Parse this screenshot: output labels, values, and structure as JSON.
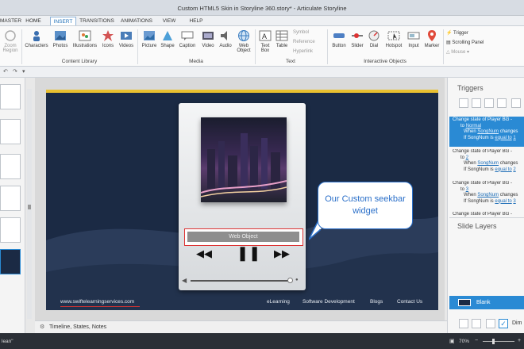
{
  "window": {
    "title": "Custom HTML5 Skin in Storyline 360.story* - Articulate Storyline"
  },
  "tabs": [
    {
      "label": "MASTER"
    },
    {
      "label": "HOME"
    },
    {
      "label": "INSERT"
    },
    {
      "label": "TRANSITIONS"
    },
    {
      "label": "ANIMATIONS"
    },
    {
      "label": "VIEW"
    },
    {
      "label": "HELP"
    }
  ],
  "ribbon": {
    "zoom": "Zoom",
    "region": "Region",
    "characters": "Characters",
    "photos": "Photos",
    "illustrations": "Illustrations",
    "icons": "Icons",
    "videos": "Videos",
    "content_library": "Content Library",
    "picture": "Picture",
    "shape": "Shape",
    "caption": "Caption",
    "video": "Video",
    "audio": "Audio",
    "web": "Web",
    "object": "Object",
    "media": "Media",
    "textbox_1": "Text",
    "textbox_2": "Box",
    "table": "Table",
    "symbol": "Symbol",
    "reference": "Reference",
    "hyperlink": "Hyperlink",
    "text": "Text",
    "button": "Button",
    "slider": "Slider",
    "dial": "Dial",
    "hotspot": "Hotspot",
    "input": "Input",
    "marker": "Marker",
    "interactive_objects": "Interactive Objects",
    "trigger": "Trigger",
    "scrolling_panel": "Scrolling Panel",
    "mouse": "Mouse"
  },
  "slide": {
    "seekbar_label": "Web Object",
    "callout": "Our Custom seekbar widget",
    "footer": {
      "website": "www.swiftelearningservices.com",
      "elearning": "eLearning",
      "software": "Software Development",
      "blogs": "Blogs",
      "contact": "Contact Us"
    }
  },
  "right_panel": {
    "triggers_title": "Triggers",
    "triggers": [
      {
        "line1": "Change state of Player BG -",
        "to": "to",
        "state": "Normal",
        "when": "When",
        "var": "SongNum",
        "changes": "changes",
        "if": "If SongNum is",
        "cond": "equal to",
        "val": "1"
      },
      {
        "line1": "Change state of Player BG -",
        "to": "to",
        "state": "2",
        "when": "When",
        "var": "SongNum",
        "changes": "changes",
        "if": "If SongNum is",
        "cond": "equal to",
        "val": "2"
      },
      {
        "line1": "Change state of Player BG -",
        "to": "to",
        "state": "3",
        "when": "When",
        "var": "SongNum",
        "changes": "changes",
        "if": "If SongNum is",
        "cond": "equal to",
        "val": "3"
      },
      {
        "line1": "Change state of Player BG -"
      }
    ],
    "slide_layers_title": "Slide Layers",
    "layer_blank": "Blank",
    "dim": "Dim"
  },
  "timeline_label": "Timeline, States, Notes",
  "status": {
    "left": "lean\"",
    "zoom": "70%"
  },
  "colors": {
    "accent": "#2a8ad4",
    "slide_bg": "#1b2a44",
    "callout": "#2a6fc9",
    "seek_border": "#dd3333"
  }
}
